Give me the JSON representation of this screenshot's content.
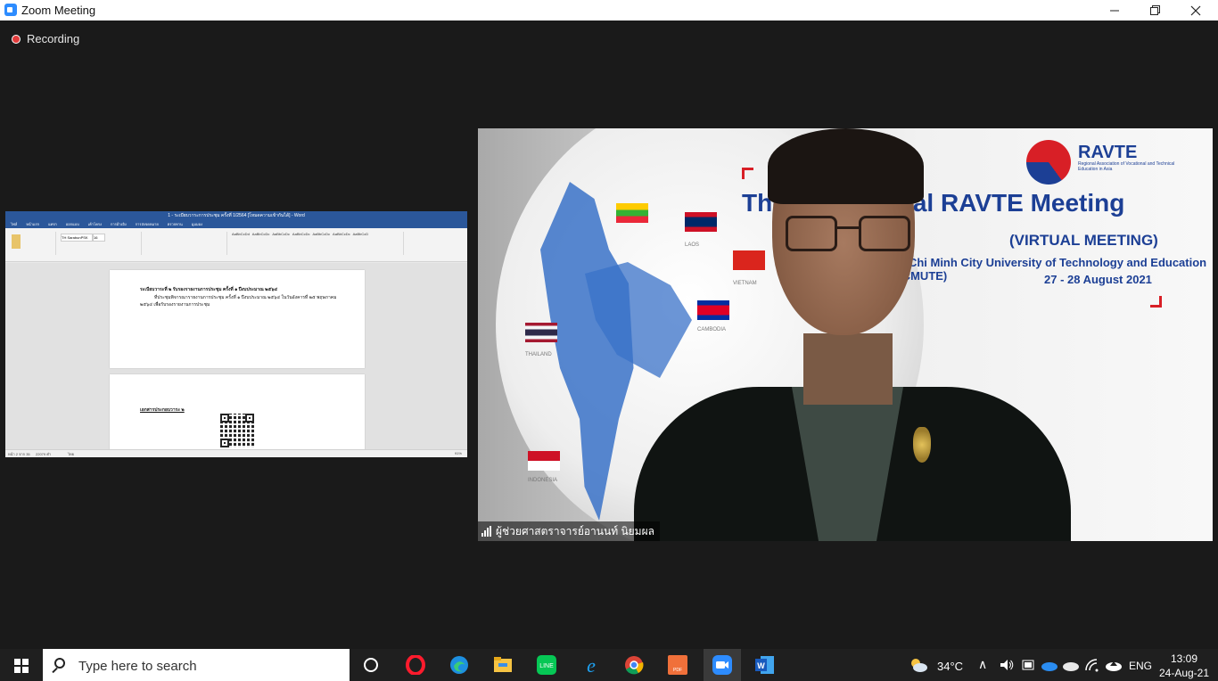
{
  "window": {
    "title": "Zoom Meeting",
    "controls": [
      "minimize",
      "restore",
      "close"
    ]
  },
  "recording": {
    "label": "Recording"
  },
  "shared_screen": {
    "app": "Word",
    "window_title": "1 - ระเบียบวาระการประชุม ครั้งที่ 1/2564 [โหมดความเข้ากันได้] - Word",
    "tabs": [
      "ไฟล์",
      "หน้าแรก",
      "แทรก",
      "ออกแบบ",
      "เค้าโครง",
      "การอ้างอิง",
      "การส่งจดหมาย",
      "ตรวจทาน",
      "มุมมอง"
    ],
    "font_name": "TH SarabunPSK",
    "font_size": "16",
    "styles": [
      "AaBbCcDd",
      "AaBbCcDc",
      "AaBbCcDc",
      "AaBbCcDc",
      "AaBbCcDc",
      "AaBbCcDc",
      "AaBbCcD"
    ],
    "page1_heading": "ระเบียบวาระที่ ๒ รับรองรายงานการประชุม ครั้งที่ ๑ ปีงบประมาณ ๒๕๖๔",
    "page1_line2": "ที่ประชุมพิจารณารายงานการประชุม ครั้งที่ ๑ ปีงบประมาณ ๒๕๖๔ ในวันอังคารที่ ๒๕ พฤษภาคม",
    "page1_line3": "๒๕๖๔ เพื่อรับรองรายงานการประชุม",
    "page2_heading": "เอกสารประกอบวาระ ๒",
    "status_left": "หน้า 2 จาก 35",
    "status_words": "22079 คำ",
    "status_lang": "ไทย",
    "zoom": "91%"
  },
  "video_tile": {
    "participant_name": "ผู้ช่วยศาสตราจารย์อานนท์ นิยมผล",
    "background": {
      "logo_text": "RAVTE",
      "logo_sub": "Regional Association of Vocational and Technical Education in Asia",
      "headline": "The 11th Annual RAVTE Meeting",
      "sub1": "(VIRTUAL MEETING)",
      "sub2": "Ho Chi Minh City University of Technology and Education (HCMUTE)",
      "sub3": "27 - 28 August 2021",
      "flags": [
        "MYANMAR",
        "LAOS",
        "VIETNAM",
        "THAILAND",
        "CAMBODIA",
        "INDONESIA"
      ]
    }
  },
  "taskbar": {
    "search_placeholder": "Type here to search",
    "apps": [
      "task-view",
      "opera",
      "edge",
      "file-explorer",
      "line",
      "internet-explorer",
      "chrome",
      "foxit-pdf",
      "zoom",
      "word"
    ],
    "weather": "34°C",
    "language": "ENG",
    "time": "13:09",
    "date": "24-Aug-21"
  },
  "colors": {
    "zoom_blue": "#2d8cff",
    "word_blue": "#2b579a",
    "ravte_blue": "#1c3f95",
    "ravte_red": "#d81f26",
    "recording_red": "#e23b3b"
  }
}
